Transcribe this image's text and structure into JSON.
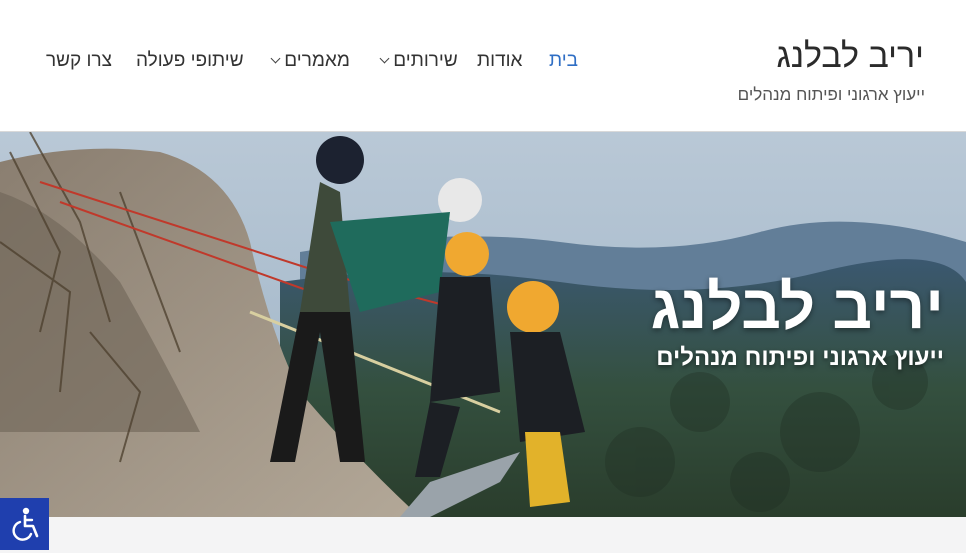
{
  "site": {
    "title": "יריב לבלנג",
    "tagline": "ייעוץ ארגוני ופיתוח מנהלים"
  },
  "nav": {
    "items": [
      {
        "label": "בית",
        "active": true,
        "has_submenu": false
      },
      {
        "label": "אודות",
        "active": false,
        "has_submenu": false
      },
      {
        "label": "שירותים",
        "active": false,
        "has_submenu": true
      },
      {
        "label": "מאמרים",
        "active": false,
        "has_submenu": true
      },
      {
        "label": "שיתופי פעולה",
        "active": false,
        "has_submenu": false
      },
      {
        "label": "צרו קשר",
        "active": false,
        "has_submenu": false
      }
    ]
  },
  "hero": {
    "title": "יריב לבלנג",
    "subtitle": "ייעוץ ארגוני ופיתוח מנהלים",
    "image_icon": "rappelling-photo"
  },
  "accessibility": {
    "icon": "wheelchair-icon"
  },
  "colors": {
    "accent": "#2f6ec4",
    "accessibility_bg": "#1f3fae",
    "header_bg": "#ffffff"
  }
}
